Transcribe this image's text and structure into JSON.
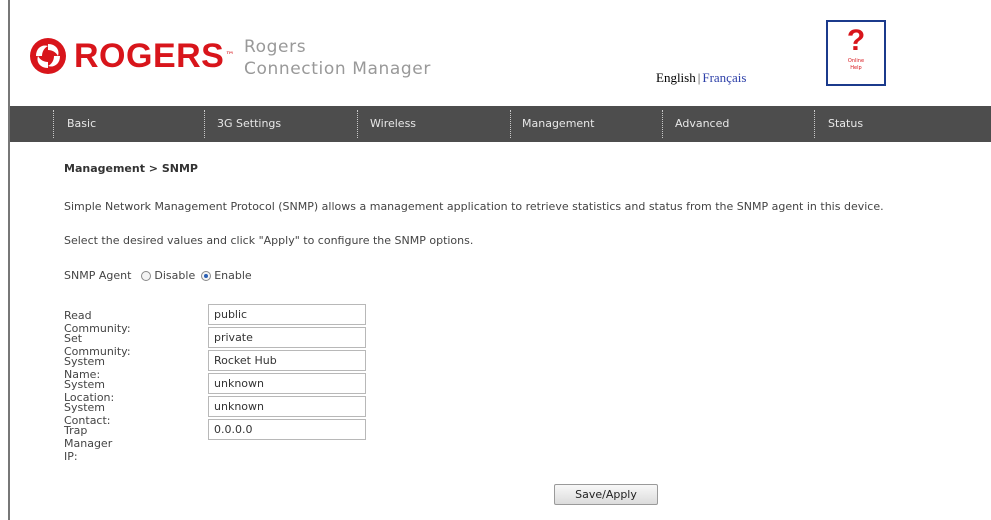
{
  "header": {
    "brand": "ROGERS",
    "brand_tm": "™",
    "product_line1": "Rogers",
    "product_line2": "Connection Manager",
    "lang_english": "English",
    "lang_separator": "|",
    "lang_french": "Français",
    "help_mark": "?",
    "help_label_line1": "Online",
    "help_label_line2": "Help",
    "accent_color": "#d8151b"
  },
  "nav": {
    "items": [
      {
        "label": "Basic"
      },
      {
        "label": "3G Settings"
      },
      {
        "label": "Wireless"
      },
      {
        "label": "Management"
      },
      {
        "label": "Advanced"
      },
      {
        "label": "Status"
      }
    ],
    "background": "#4d4d4d"
  },
  "main": {
    "title": "Management > SNMP",
    "description": "Simple Network Management Protocol (SNMP) allows a management application to retrieve statistics and status from the SNMP agent in this device.",
    "instruction": "Select the desired values and click \"Apply\" to configure the SNMP options.",
    "agent": {
      "label": "SNMP Agent",
      "option_disable": "Disable",
      "option_enable": "Enable",
      "selected": "Enable"
    },
    "fields": [
      {
        "label": "Read Community:",
        "value": "public"
      },
      {
        "label": "Set Community:",
        "value": "private"
      },
      {
        "label": "System Name:",
        "value": "Rocket Hub"
      },
      {
        "label": "System Location:",
        "value": "unknown"
      },
      {
        "label": "System Contact:",
        "value": "unknown"
      },
      {
        "label": "Trap Manager IP:",
        "value": "0.0.0.0"
      }
    ],
    "apply_label": "Save/Apply"
  }
}
